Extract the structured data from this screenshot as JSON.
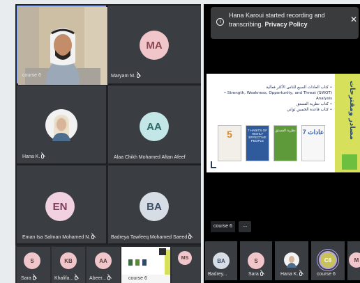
{
  "colors": {
    "tile": "#3a3d42",
    "avatar_ma": "#f1c6cb",
    "avatar_aa": "#c3e6e6",
    "avatar_en": "#f1d0e0",
    "avatar_ba": "#d7dde5",
    "accent_ring": "#b7a7e6"
  },
  "left_panel": {
    "tiles": [
      {
        "label": "course 6"
      },
      {
        "initials": "MA",
        "name": "Maryam M."
      },
      {
        "name": "Hana K."
      },
      {
        "initials": "AA",
        "name": "Alaa Chikh Mohamed Aftan Afeef"
      },
      {
        "initials": "EN",
        "name": "Eman Isa Salman Mohamed N."
      },
      {
        "initials": "BA",
        "name": "Badreya Tawfeeq Mohamed Saeed"
      }
    ],
    "strip": [
      {
        "initials": "S",
        "name": "Sara"
      },
      {
        "initials": "KB",
        "name": "Khalifa..."
      },
      {
        "initials": "AA",
        "name": "Abeer..."
      },
      {
        "name": "course 6"
      },
      {
        "initials": "MS",
        "name": ""
      }
    ]
  },
  "right_panel": {
    "toast": {
      "text": "Hana Karoui started recording and transcribing.",
      "link": "Privacy Policy"
    },
    "slide": {
      "title": "مصادر ومقترحات",
      "bullets": [
        "كتاب العادات السبع للناس الأكثر فعالية",
        "Strength, Weakness, Opportunity, and Threat (SWOT) Analysis",
        "كتاب نظرية الفستق",
        "كتاب قاعدة الخمس ثواني"
      ],
      "books": [
        "5",
        "7 HABITS OF HIGHLY EFFECTIVE PEOPLE",
        "نظرية الفستق",
        "7 عادات"
      ]
    },
    "presenter_label": "course 6",
    "more_label": "...",
    "strip": [
      {
        "initials": "BA",
        "name": "Badrey..."
      },
      {
        "initials": "S",
        "name": "Sara"
      },
      {
        "name": "Hana K."
      },
      {
        "initials": "C6",
        "name": "course 6"
      },
      {
        "initials": "M",
        "name": ""
      }
    ]
  }
}
